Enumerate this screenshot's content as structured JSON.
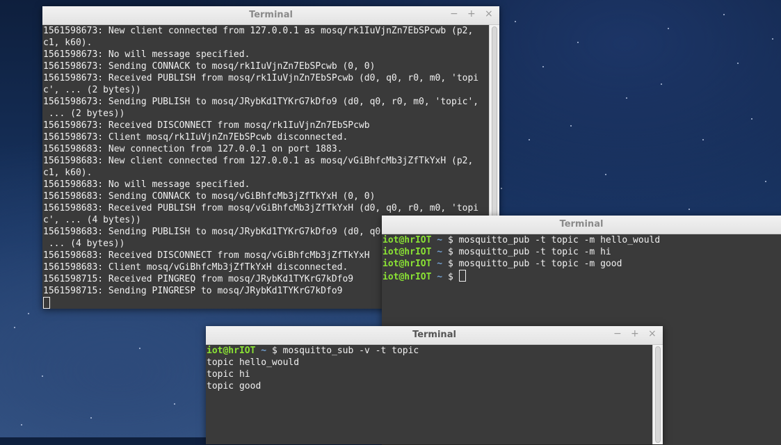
{
  "windows": {
    "broker": {
      "title": "Terminal",
      "lines": [
        "1561598673: New client connected from 127.0.0.1 as mosq/rk1IuVjnZn7EbSPcwb (p2,",
        "c1, k60).",
        "1561598673: No will message specified.",
        "1561598673: Sending CONNACK to mosq/rk1IuVjnZn7EbSPcwb (0, 0)",
        "1561598673: Received PUBLISH from mosq/rk1IuVjnZn7EbSPcwb (d0, q0, r0, m0, 'topi",
        "c', ... (2 bytes))",
        "1561598673: Sending PUBLISH to mosq/JRybKd1TYKrG7kDfo9 (d0, q0, r0, m0, 'topic',",
        " ... (2 bytes))",
        "1561598673: Received DISCONNECT from mosq/rk1IuVjnZn7EbSPcwb",
        "1561598673: Client mosq/rk1IuVjnZn7EbSPcwb disconnected.",
        "1561598683: New connection from 127.0.0.1 on port 1883.",
        "1561598683: New client connected from 127.0.0.1 as mosq/vGiBhfcMb3jZfTkYxH (p2,",
        "c1, k60).",
        "1561598683: No will message specified.",
        "1561598683: Sending CONNACK to mosq/vGiBhfcMb3jZfTkYxH (0, 0)",
        "1561598683: Received PUBLISH from mosq/vGiBhfcMb3jZfTkYxH (d0, q0, r0, m0, 'topi",
        "c', ... (4 bytes))",
        "1561598683: Sending PUBLISH to mosq/JRybKd1TYKrG7kDfo9 (d0, q0, r0, m0, 'topic',",
        " ... (4 bytes))",
        "1561598683: Received DISCONNECT from mosq/vGiBhfcMb3jZfTkYxH",
        "1561598683: Client mosq/vGiBhfcMb3jZfTkYxH disconnected.",
        "1561598715: Received PINGREQ from mosq/JRybKd1TYKrG7kDfo9",
        "1561598715: Sending PINGRESP to mosq/JRybKd1TYKrG7kDfo9"
      ]
    },
    "publisher": {
      "title": "Terminal",
      "prompt_user": "iot@hrIOT",
      "prompt_tilde": "~",
      "prompt_dollar": "$",
      "commands": [
        "mosquitto_pub -t topic -m hello_would",
        "mosquitto_pub -t topic -m hi",
        "mosquitto_pub -t topic -m good"
      ]
    },
    "subscriber": {
      "title": "Terminal",
      "prompt_user": "iot@hrIOT",
      "prompt_tilde": "~",
      "prompt_dollar": "$",
      "command": "mosquitto_sub -v -t topic",
      "output": [
        "topic hello_would",
        "topic hi",
        "topic good"
      ]
    }
  },
  "controls": {
    "minimize": "−",
    "maximize": "+",
    "close": "×"
  }
}
